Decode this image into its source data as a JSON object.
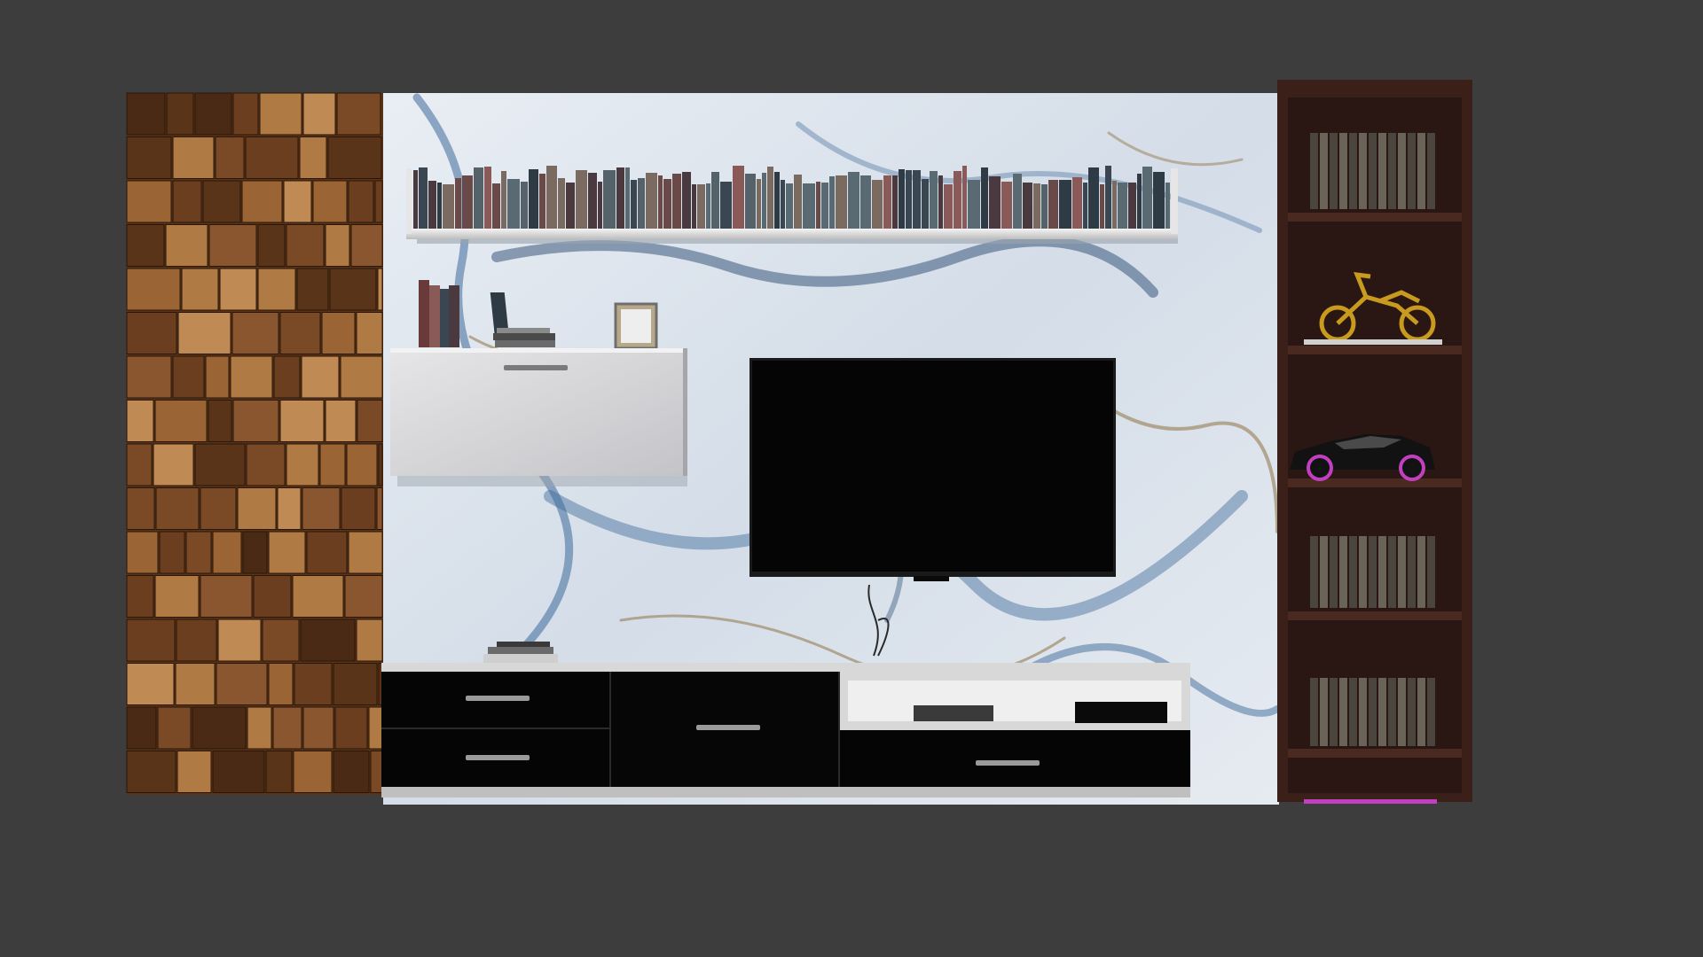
{
  "scene": {
    "background_color": "#3d3d3d",
    "wood_panel": {
      "tile_colors": [
        "#7a4a26",
        "#5a3418",
        "#9a6434",
        "#b07a44",
        "#4a2a14",
        "#8a5630",
        "#c08a54",
        "#6a3e1e"
      ]
    },
    "marble_wall": {
      "base_color": "#dde4ec",
      "vein_colors": [
        "#3e6a9a",
        "#7a98b8",
        "#a08c6a",
        "#2a4a72"
      ]
    },
    "top_shelf": {
      "color": "#eeeeee",
      "book_colors": [
        "#3a4652",
        "#6a4a48",
        "#5a6a72",
        "#4a3a40",
        "#7a6a60",
        "#2e3a44",
        "#8a5a58",
        "#56626a"
      ]
    },
    "wall_cabinet": {
      "color": "#d9d9db"
    },
    "tv": {
      "screen_color": "#050505",
      "frame_color": "#1a1a1a"
    },
    "console": {
      "top_color": "#d8d8d8",
      "drawer_color": "#050505",
      "handle_color": "#9a9a9a"
    },
    "bookcase": {
      "frame_color": "#3a2018",
      "back_color": "#2a1612",
      "accent_color": "#c040c0",
      "decor": {
        "motorcycle_color": "#c89a1e",
        "car_color": "#121212",
        "car_rim_color": "#c040c0"
      }
    }
  }
}
